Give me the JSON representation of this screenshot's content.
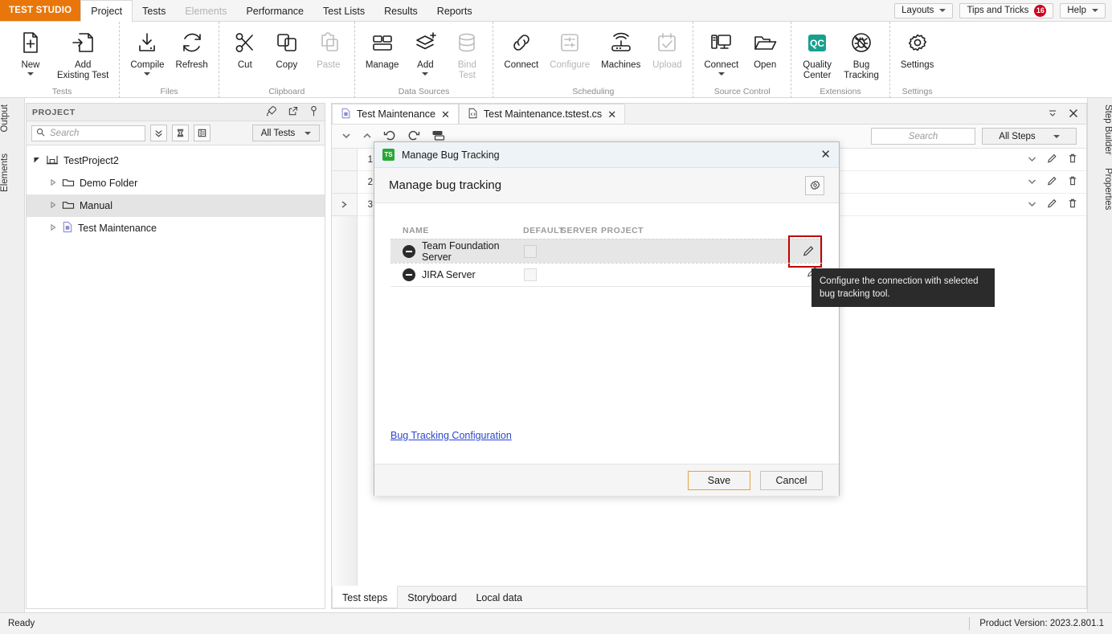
{
  "menubar": {
    "brand": "TEST STUDIO",
    "items": [
      {
        "label": "Project",
        "state": "active"
      },
      {
        "label": "Tests",
        "state": "normal"
      },
      {
        "label": "Elements",
        "state": "disabled"
      },
      {
        "label": "Performance",
        "state": "normal"
      },
      {
        "label": "Test Lists",
        "state": "normal"
      },
      {
        "label": "Results",
        "state": "normal"
      },
      {
        "label": "Reports",
        "state": "normal"
      }
    ],
    "layouts_label": "Layouts",
    "tips_label": "Tips and Tricks",
    "tips_count": "16",
    "help_label": "Help"
  },
  "ribbon": {
    "groups": [
      {
        "label": "Tests",
        "buttons": [
          {
            "name": "new",
            "label": "New",
            "icon": "new-file-icon",
            "dropdown": true,
            "disabled": false
          },
          {
            "name": "add-existing-test",
            "label": "Add\nExisting Test",
            "icon": "add-existing-icon",
            "dropdown": false,
            "disabled": false
          }
        ]
      },
      {
        "label": "Files",
        "buttons": [
          {
            "name": "compile",
            "label": "Compile",
            "icon": "compile-icon",
            "dropdown": true,
            "disabled": false
          },
          {
            "name": "refresh",
            "label": "Refresh",
            "icon": "refresh-icon",
            "dropdown": false,
            "disabled": false
          }
        ]
      },
      {
        "label": "Clipboard",
        "buttons": [
          {
            "name": "cut",
            "label": "Cut",
            "icon": "scissors-icon",
            "dropdown": false,
            "disabled": false
          },
          {
            "name": "copy",
            "label": "Copy",
            "icon": "copy-icon",
            "dropdown": false,
            "disabled": false
          },
          {
            "name": "paste",
            "label": "Paste",
            "icon": "clipboard-icon",
            "dropdown": false,
            "disabled": true
          }
        ]
      },
      {
        "label": "Data Sources",
        "buttons": [
          {
            "name": "manage",
            "label": "Manage",
            "icon": "grid-rows-icon",
            "dropdown": false,
            "disabled": false
          },
          {
            "name": "add-data-source",
            "label": "Add",
            "icon": "layers-plus-icon",
            "dropdown": true,
            "disabled": false
          },
          {
            "name": "bind-test",
            "label": "Bind\nTest",
            "icon": "database-icon",
            "dropdown": false,
            "disabled": true
          }
        ]
      },
      {
        "label": "Scheduling",
        "buttons": [
          {
            "name": "connect-scheduling",
            "label": "Connect",
            "icon": "link-icon",
            "dropdown": false,
            "disabled": false
          },
          {
            "name": "configure",
            "label": "Configure",
            "icon": "sliders-icon",
            "dropdown": false,
            "disabled": true
          },
          {
            "name": "machines",
            "label": "Machines",
            "icon": "router-icon",
            "dropdown": false,
            "disabled": false
          },
          {
            "name": "upload",
            "label": "Upload",
            "icon": "calendar-check-icon",
            "dropdown": false,
            "disabled": true
          }
        ]
      },
      {
        "label": "Source Control",
        "buttons": [
          {
            "name": "connect-source-control",
            "label": "Connect",
            "icon": "computer-icon",
            "dropdown": true,
            "disabled": false
          },
          {
            "name": "open",
            "label": "Open",
            "icon": "folder-open-icon",
            "dropdown": false,
            "disabled": false
          }
        ]
      },
      {
        "label": "Extensions",
        "buttons": [
          {
            "name": "quality-center",
            "label": "Quality\nCenter",
            "icon": "qc-icon",
            "dropdown": false,
            "disabled": false
          },
          {
            "name": "bug-tracking",
            "label": "Bug\nTracking",
            "icon": "bug-disabled-icon",
            "dropdown": false,
            "disabled": false
          }
        ]
      },
      {
        "label": "Settings",
        "buttons": [
          {
            "name": "settings",
            "label": "Settings",
            "icon": "gear-icon",
            "dropdown": false,
            "disabled": false
          }
        ]
      }
    ]
  },
  "left_dock": {
    "tabs": [
      "Output",
      "Elements"
    ]
  },
  "right_dock": {
    "tabs": [
      "Step Builder",
      "Properties"
    ]
  },
  "project_panel": {
    "title": "PROJECT",
    "search_placeholder": "Search",
    "filter_label": "All Tests",
    "tree": [
      {
        "label": "TestProject2",
        "level": 0,
        "icon": "project-icon",
        "expanded": true,
        "selected": false
      },
      {
        "label": "Demo Folder",
        "level": 1,
        "icon": "folder-icon",
        "expanded": false,
        "selected": false
      },
      {
        "label": "Manual",
        "level": 1,
        "icon": "folder-icon",
        "expanded": false,
        "selected": true
      },
      {
        "label": "Test Maintenance",
        "level": 1,
        "icon": "test-file-icon",
        "expanded": false,
        "selected": false
      }
    ]
  },
  "doc_area": {
    "tabs": [
      {
        "label": "Test Maintenance",
        "icon": "test-file-icon",
        "active": true
      },
      {
        "label": "Test Maintenance.tstest.cs",
        "icon": "code-file-icon",
        "active": false
      }
    ],
    "search_placeholder": "Search",
    "steps_filter_label": "All Steps",
    "row_numbers": [
      "1",
      "2",
      "3"
    ],
    "bottom_tabs": [
      {
        "label": "Test steps",
        "active": true
      },
      {
        "label": "Storyboard",
        "active": false
      },
      {
        "label": "Local data",
        "active": false
      }
    ]
  },
  "modal": {
    "title": "Manage Bug Tracking",
    "subtitle": "Manage bug tracking",
    "logo_text": "TS",
    "columns": [
      "NAME",
      "DEFAULT",
      "SERVER",
      "PROJECT"
    ],
    "rows": [
      {
        "name": "Team Foundation Server",
        "default_checked": false,
        "server": "",
        "project": "",
        "selected": true
      },
      {
        "name": "JIRA Server",
        "default_checked": false,
        "server": "",
        "project": "",
        "selected": false
      }
    ],
    "config_link": "Bug Tracking Configuration",
    "save_label": "Save",
    "cancel_label": "Cancel",
    "tooltip": "Configure the connection with selected bug tracking tool.",
    "highlight_color": "#c00000",
    "accent_color": "#e8a13a"
  },
  "statusbar": {
    "status": "Ready",
    "product_version": "Product Version: 2023.2.801.1"
  }
}
